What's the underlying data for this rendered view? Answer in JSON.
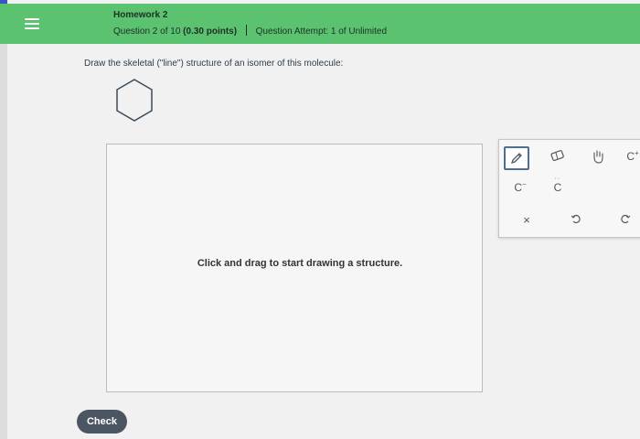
{
  "header": {
    "title": "Homework 2",
    "question": "Question 2 of 10",
    "points": "(0.30 points)",
    "attempt": "Question Attempt: 1 of Unlimited"
  },
  "question": {
    "prompt": "Draw the skeletal (\"line\") structure of an isomer of this molecule:"
  },
  "canvas": {
    "hint": "Click and drag to start drawing a structure."
  },
  "toolbar": {
    "tools": [
      "pencil-icon",
      "eraser-icon",
      "hand-icon",
      "carbocation-label",
      "carbanion-label",
      "carbene-label",
      "clear-icon",
      "undo-icon",
      "redo-icon"
    ],
    "carbocation": "C",
    "carbocation_sup": "+",
    "carbanion": "C",
    "carbanion_sup": "−",
    "carbene": "C",
    "clear": "×"
  },
  "actions": {
    "check": "Check"
  },
  "colors": {
    "header": "#5bc270",
    "accent": "#3b56c4",
    "check_button": "#4c5663"
  }
}
